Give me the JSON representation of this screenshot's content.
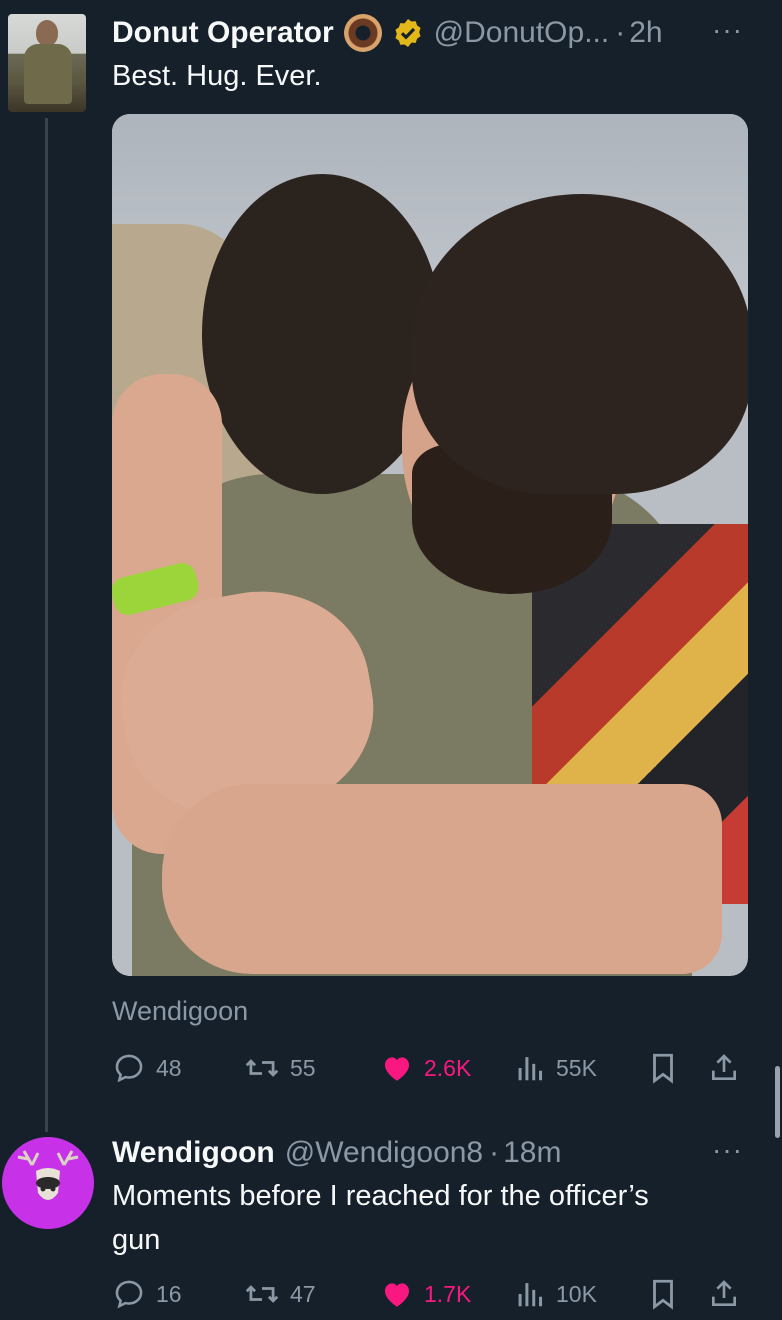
{
  "tweet1": {
    "display_name": "Donut Operator",
    "handle": "@DonutOp...",
    "separator": "·",
    "time": "2h",
    "more": "···",
    "text": "Best. Hug. Ever.",
    "source_label": "Wendigoon",
    "replies": "48",
    "retweets": "55",
    "likes": "2.6K",
    "views": "55K"
  },
  "tweet2": {
    "display_name": "Wendigoon",
    "handle": "@Wendigoon8",
    "separator": "·",
    "time": "18m",
    "more": "···",
    "text_line1": "Moments before I reached for the officer’s",
    "text_line2": "gun",
    "replies": "16",
    "retweets": "47",
    "likes": "1.7K",
    "views": "10K"
  },
  "colors": {
    "background": "#15202b",
    "like": "#f91880",
    "muted": "#8b98a5",
    "verified": "#e2b719"
  },
  "icons": [
    "donut-icon",
    "verified-icon",
    "reply-icon",
    "retweet-icon",
    "like-icon",
    "views-icon",
    "bookmark-icon",
    "share-icon"
  ]
}
